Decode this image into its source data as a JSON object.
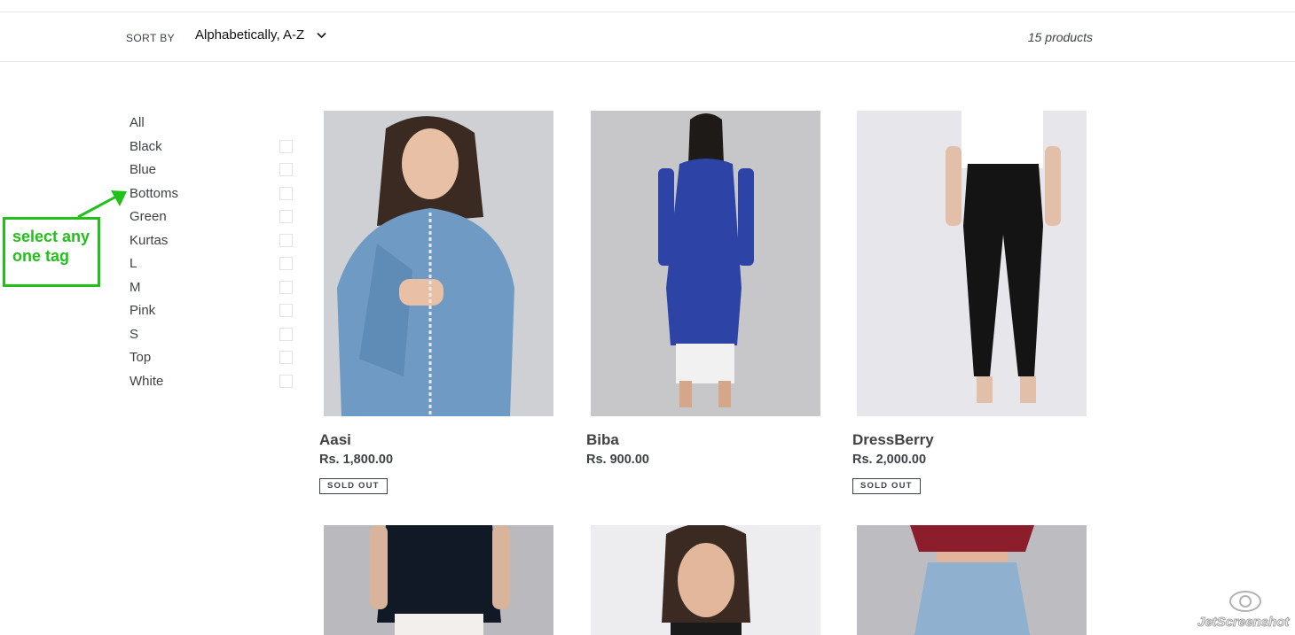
{
  "sort": {
    "label": "SORT BY",
    "value": "Alphabetically, A-Z"
  },
  "product_count": "15 products",
  "tags": [
    "All",
    "Black",
    "Blue",
    "Bottoms",
    "Green",
    "Kurtas",
    "L",
    "M",
    "Pink",
    "S",
    "Top",
    "White"
  ],
  "annotation": {
    "text_line1": "select any",
    "text_line2": "one tag",
    "color": "#22c01a"
  },
  "products": [
    {
      "name": "Aasi",
      "price": "Rs. 1,800.00",
      "badge": "SOLD OUT"
    },
    {
      "name": "Biba",
      "price": "Rs. 900.00",
      "badge": ""
    },
    {
      "name": "DressBerry",
      "price": "Rs. 2,000.00",
      "badge": "SOLD OUT"
    }
  ],
  "watermark": "JetScreenshot"
}
